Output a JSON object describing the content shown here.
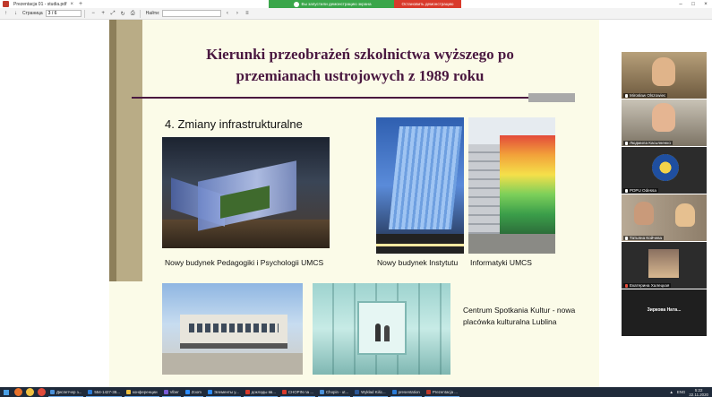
{
  "window": {
    "tab_title": "Prezentacja 01 - studia.pdf",
    "tab_close": "×",
    "tab_new": "+",
    "controls": [
      "–",
      "□",
      "×"
    ]
  },
  "share_banner": {
    "status": "Вы запустили демонстрацию экрана",
    "stop_label": "Остановить демонстрацию"
  },
  "toolbar": {
    "page_label": "Страница",
    "page_value": "3 / 6",
    "find_label": "Найти:",
    "find_value": "",
    "prev_arrow": "‹",
    "next_arrow": "›",
    "page_up": "↑",
    "page_down": "↓"
  },
  "slide": {
    "title": "Kierunki przeobrażeń szkolnictwa wyższego po przemianach ustrojowych z 1989 roku",
    "section_heading": "4. Zmiany infrastrukturalne",
    "caption_pedagogy": "Nowy budynek Pedagogiki i Psychologii UMCS",
    "caption_institute": "Nowy budynek Instytutu",
    "caption_informatics": "Informatyki UMCS",
    "caption_center": "Centrum Spotkania Kultur - nowa placówka kulturalna Lublina"
  },
  "participants": [
    {
      "name": "Mirosław Olszowiec",
      "muted": false
    },
    {
      "name": "Людмила Касьяненко",
      "muted": false
    },
    {
      "name": "PDPU Odessa",
      "muted": false
    },
    {
      "name": "Татьяна Койчева",
      "muted": false
    },
    {
      "name": "Екатерина Халецкая",
      "muted": true
    },
    {
      "name": "Зиркова Ната...",
      "muted": false
    }
  ],
  "taskbar": {
    "tasks": [
      {
        "label": "Диспетчер з...",
        "color": "#4a90d9"
      },
      {
        "label": "554-1427-38...",
        "color": "#2b7bd6"
      },
      {
        "label": "конференции",
        "color": "#f0c040"
      },
      {
        "label": "Viber",
        "color": "#7b5cd6"
      },
      {
        "label": "Zoom",
        "color": "#2d8cff"
      },
      {
        "label": "Элементы у...",
        "color": "#2d8cff"
      },
      {
        "label": "доклады вв...",
        "color": "#d93a2b"
      },
      {
        "label": "CHOPIN na ...",
        "color": "#d93a2b"
      },
      {
        "label": "Chopin - ut...",
        "color": "#4a90d9"
      },
      {
        "label": "Wykład Kiśc...",
        "color": "#2b5797"
      },
      {
        "label": "presentation",
        "color": "#2b7bd6"
      },
      {
        "label": "Prezentacja ...",
        "color": "#c0392b"
      }
    ],
    "lang": "ENG",
    "time": "5:22",
    "date": "22.11.2020"
  },
  "colors": {
    "slide_bg": "#fbfbe8",
    "slide_title": "#4a1840",
    "share_green": "#3aa64a",
    "share_red": "#d93a2b",
    "taskbar": "#1f2a3a"
  }
}
